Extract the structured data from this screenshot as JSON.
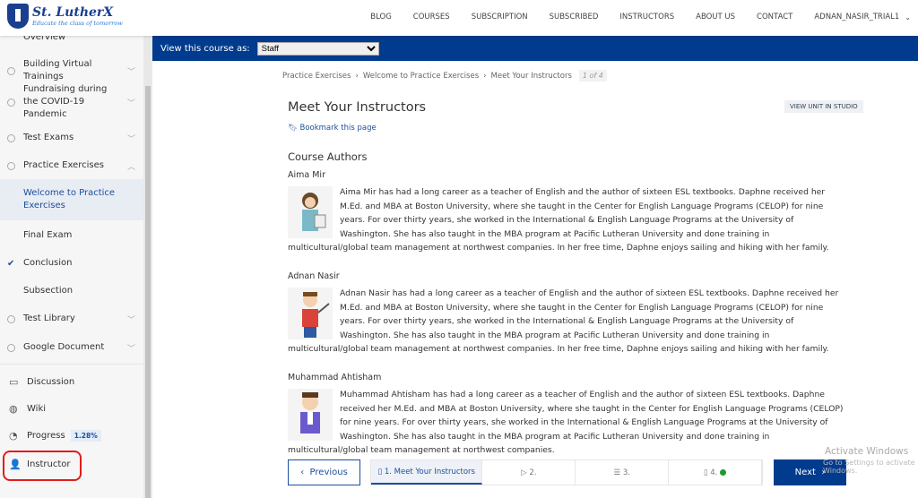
{
  "header": {
    "logo_title": "St. LutherX",
    "logo_tagline": "Educate the class of tomorrow",
    "nav": [
      "BLOG",
      "COURSES",
      "SUBSCRIPTION",
      "SUBSCRIBED",
      "INSTRUCTORS",
      "ABOUT US",
      "CONTACT"
    ],
    "user": "ADNAN_NASIR_TRIAL1"
  },
  "sidebar": {
    "items": [
      {
        "label": "Overview"
      },
      {
        "label": "Building Virtual Trainings"
      },
      {
        "label": "Fundraising during the COVID-19 Pandemic"
      },
      {
        "label": "Test Exams"
      },
      {
        "label": "Practice Exercises"
      },
      {
        "label": "Welcome to Practice Exercises"
      },
      {
        "label": "Final Exam"
      },
      {
        "label": "Conclusion"
      },
      {
        "label": "Subsection"
      },
      {
        "label": "Test Library"
      },
      {
        "label": "Google Document"
      }
    ],
    "tools": {
      "discussion": "Discussion",
      "wiki": "Wiki",
      "progress": "Progress",
      "progress_value": "1.28%",
      "instructor": "Instructor"
    }
  },
  "viewbar": {
    "label": "View this course as:",
    "selected": "Staff"
  },
  "breadcrumb": {
    "items": [
      "Practice Exercises",
      "Welcome to Practice Exercises",
      "Meet Your Instructors"
    ],
    "page": "1 of 4"
  },
  "main": {
    "title": "Meet Your Instructors",
    "studio_button": "VIEW UNIT IN STUDIO",
    "bookmark": "Bookmark this page",
    "section": "Course Authors",
    "authors": [
      {
        "name": "Aima Mir",
        "bio": "Aima Mir has had a long career as a teacher of English and the author of sixteen ESL textbooks. Daphne received her M.Ed. and MBA at Boston University, where she taught in the Center for English Language Programs (CELOP) for nine years. For over thirty years, she worked in the International & English Language Programs at the University of Washington. She has also taught in the MBA program at Pacific Lutheran University and done training in multicultural/global team management at northwest companies. In her free time, Daphne enjoys sailing and hiking with her family."
      },
      {
        "name": "Adnan Nasir",
        "bio": "Adnan Nasir has had a long career as a teacher of English and the author of sixteen ESL textbooks. Daphne received her M.Ed. and MBA at Boston University, where she taught in the Center for English Language Programs (CELOP) for nine years. For over thirty years, she worked in the International & English Language Programs at the University of Washington. She has also taught in the MBA program at Pacific Lutheran University and done training in multicultural/global team management at northwest companies. In her free time, Daphne enjoys sailing and hiking with her family."
      },
      {
        "name": "Muhammad Ahtisham",
        "bio": "Muhammad Ahtisham has had a long career as a teacher of English and the author of sixteen ESL textbooks. Daphne received her M.Ed. and MBA at Boston University, where she taught in the Center for English Language Programs (CELOP) for nine years. For over thirty years, she worked in the International & English Language Programs at the University of Washington. She has also taught in the MBA program at Pacific Lutheran University and done training in multicultural/global team management at northwest companies."
      }
    ]
  },
  "bottom": {
    "previous": "Previous",
    "next": "Next",
    "units": [
      "1. Meet Your Instructors",
      "2.",
      "3.",
      "4."
    ]
  },
  "watermark": {
    "line1": "Activate Windows",
    "line2": "Go to Settings to activate Windows."
  }
}
